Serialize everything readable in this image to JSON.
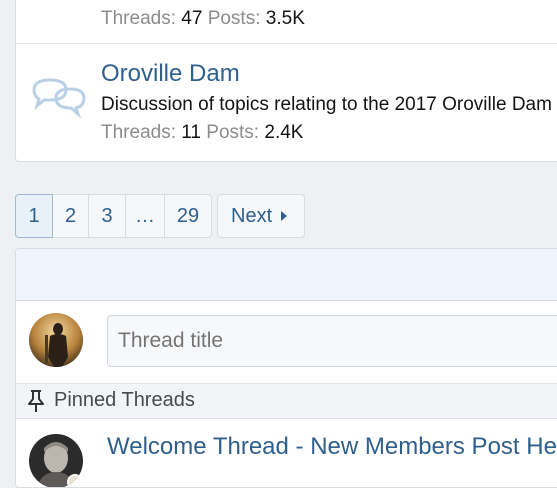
{
  "forums": [
    {
      "threads_label": "Threads:",
      "threads_value": "47",
      "posts_label": "Posts:",
      "posts_value": "3.5K"
    },
    {
      "icon": "chat-bubbles-icon",
      "title": "Oroville Dam",
      "description": "Discussion of topics relating to the 2017 Oroville Dam",
      "threads_label": "Threads:",
      "threads_value": "11",
      "posts_label": "Posts:",
      "posts_value": "2.4K"
    }
  ],
  "pagination": {
    "pages": [
      "1",
      "2",
      "3",
      "…",
      "29"
    ],
    "current": "1",
    "next_label": "Next"
  },
  "quick_thread": {
    "placeholder": "Thread title"
  },
  "pinned": {
    "label": "Pinned Threads"
  },
  "threads": [
    {
      "title": "Welcome Thread - New Members Post Here"
    }
  ],
  "colors": {
    "link": "#2f5f8d",
    "header_bg": "#edf4fb"
  }
}
